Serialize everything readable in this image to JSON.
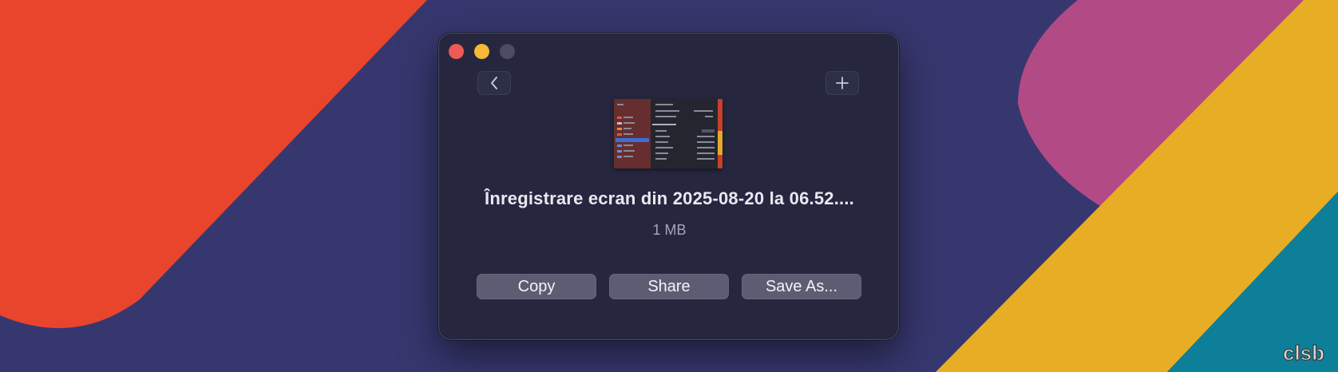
{
  "window": {
    "title_file": "Înregistrare ecran din 2025-08-20 la 06.52....",
    "size": "1 MB"
  },
  "actions": {
    "copy": "Copy",
    "share": "Share",
    "save_as": "Save As..."
  },
  "icons": {
    "back": "chevron-left-icon",
    "add": "plus-icon"
  },
  "colors": {
    "background": "#37376f",
    "orange_stripe": "#e8452c",
    "magenta_stripe": "#b24a86",
    "yellow_stripe": "#e7ad24",
    "teal_stripe": "#0d7f98",
    "window_bg": "#26273f",
    "button_bg": "#5c5d73"
  },
  "watermark": "clsb"
}
